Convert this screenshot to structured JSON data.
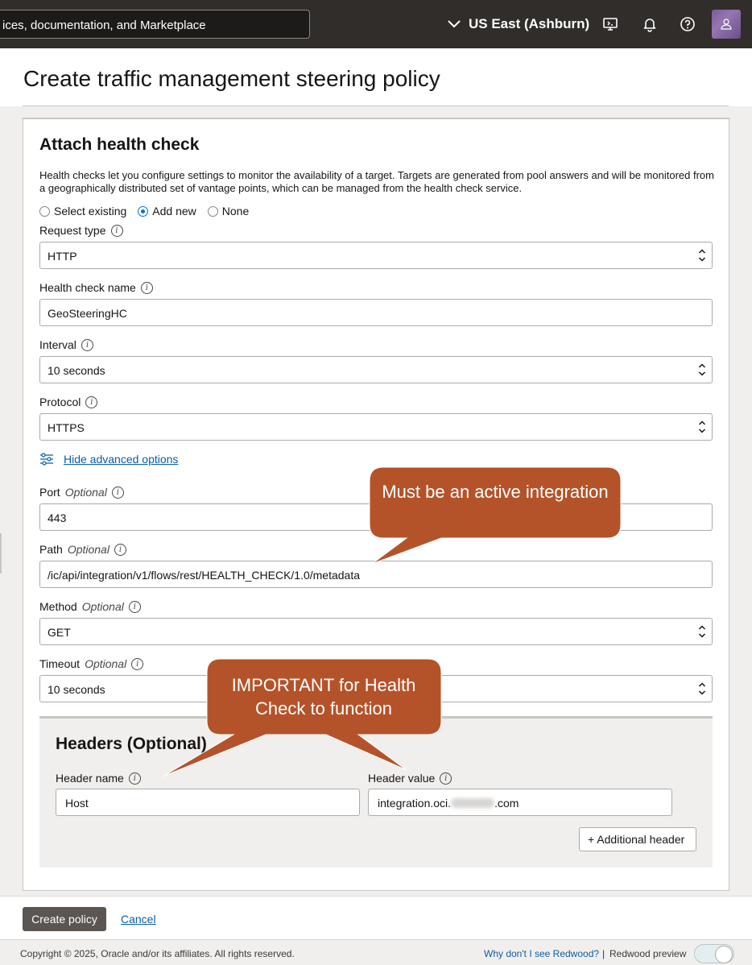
{
  "topbar": {
    "search_text": "ices, documentation, and Marketplace",
    "region": "US East (Ashburn)",
    "icons": [
      "chevron-down-icon",
      "cloud-shell-icon",
      "bell-icon",
      "help-icon",
      "user-avatar"
    ]
  },
  "page": {
    "title": "Create traffic management steering policy"
  },
  "health_check": {
    "title": "Attach health check",
    "description": "Health checks let you configure settings to monitor the availability of a target. Targets are generated from pool answers and will be monitored from a geographically distributed set of vantage points, which can be managed from the health check service.",
    "options": [
      "Select existing",
      "Add new",
      "None"
    ],
    "selected_option": "Add new",
    "request_type": {
      "label": "Request type",
      "value": "HTTP"
    },
    "name": {
      "label": "Health check name",
      "value": "GeoSteeringHC"
    },
    "interval": {
      "label": "Interval",
      "value": "10 seconds"
    },
    "protocol": {
      "label": "Protocol",
      "value": "HTTPS"
    },
    "advanced_link": "Hide advanced options",
    "port": {
      "label": "Port",
      "optional": "Optional",
      "value": "443"
    },
    "path": {
      "label": "Path",
      "optional": "Optional",
      "value": "/ic/api/integration/v1/flows/rest/HEALTH_CHECK/1.0/metadata"
    },
    "method": {
      "label": "Method",
      "optional": "Optional",
      "value": "GET"
    },
    "timeout": {
      "label": "Timeout",
      "optional": "Optional",
      "value": "10 seconds"
    }
  },
  "headers": {
    "title": "Headers (Optional)",
    "name_label": "Header name",
    "value_label": "Header value",
    "name_value": "Host",
    "value_prefix": "integration.oci.",
    "value_suffix": ".com",
    "add_button": "+ Additional header"
  },
  "actions": {
    "create": "Create policy",
    "cancel": "Cancel"
  },
  "footer": {
    "copyright": "Copyright © 2025, Oracle and/or its affiliates. All rights reserved.",
    "why_link": "Why don't I see Redwood?",
    "separator": "|",
    "redwood": "Redwood preview"
  },
  "callouts": {
    "active": "Must be an active integration",
    "important": "IMPORTANT for Health Check to function",
    "color": "#b4532a"
  }
}
